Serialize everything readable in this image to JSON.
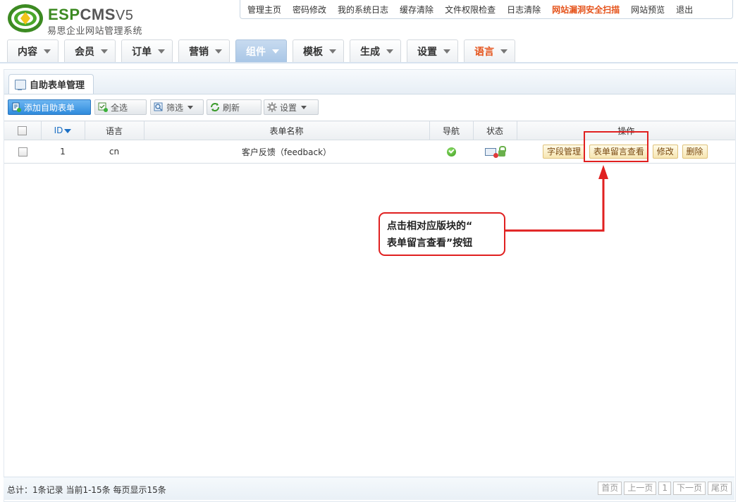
{
  "logo": {
    "brand_esp": "ESP",
    "brand_cms": "CMS",
    "brand_version": "V5",
    "subtitle": "易思企业网站管理系统"
  },
  "topnav": [
    {
      "label": "管理主页"
    },
    {
      "label": "密码修改"
    },
    {
      "label": "我的系统日志"
    },
    {
      "label": "缓存清除"
    },
    {
      "label": "文件权限检查"
    },
    {
      "label": "日志清除"
    },
    {
      "label": "网站漏洞安全扫描"
    },
    {
      "label": "网站预览"
    },
    {
      "label": "退出"
    }
  ],
  "mainnav": [
    {
      "label": "内容"
    },
    {
      "label": "会员"
    },
    {
      "label": "订单"
    },
    {
      "label": "营销"
    },
    {
      "label": "组件",
      "active": true
    },
    {
      "label": "模板"
    },
    {
      "label": "生成"
    },
    {
      "label": "设置"
    },
    {
      "label": "语言"
    }
  ],
  "page_tab": "自助表单管理",
  "toolbar": {
    "add_label": "添加自助表单",
    "select_all_label": "全选",
    "filter_label": "筛选",
    "refresh_label": "刷新",
    "settings_label": "设置"
  },
  "table": {
    "headers": [
      "ID",
      "语言",
      "表单名称",
      "导航",
      "状态",
      "操作"
    ],
    "rows": [
      {
        "id": "1",
        "lang": "cn",
        "name": "客户反馈（feedback）"
      }
    ],
    "actions": [
      "字段管理",
      "表单留言查看",
      "修改",
      "删除"
    ]
  },
  "callout": {
    "line1": "点击相对应版块的“",
    "line2": "表单留言查看”按钮"
  },
  "footer": {
    "summary": "总计：1条记录 当前1-15条 每页显示15条",
    "pager": {
      "first": "首页",
      "prev": "上一页",
      "page": "1",
      "next": "下一页",
      "last": "尾页"
    }
  },
  "colors": {
    "accent": "#2f8bdc",
    "warning": "#e5531b",
    "annotation": "#e02020",
    "brand_green": "#3c8a22"
  }
}
